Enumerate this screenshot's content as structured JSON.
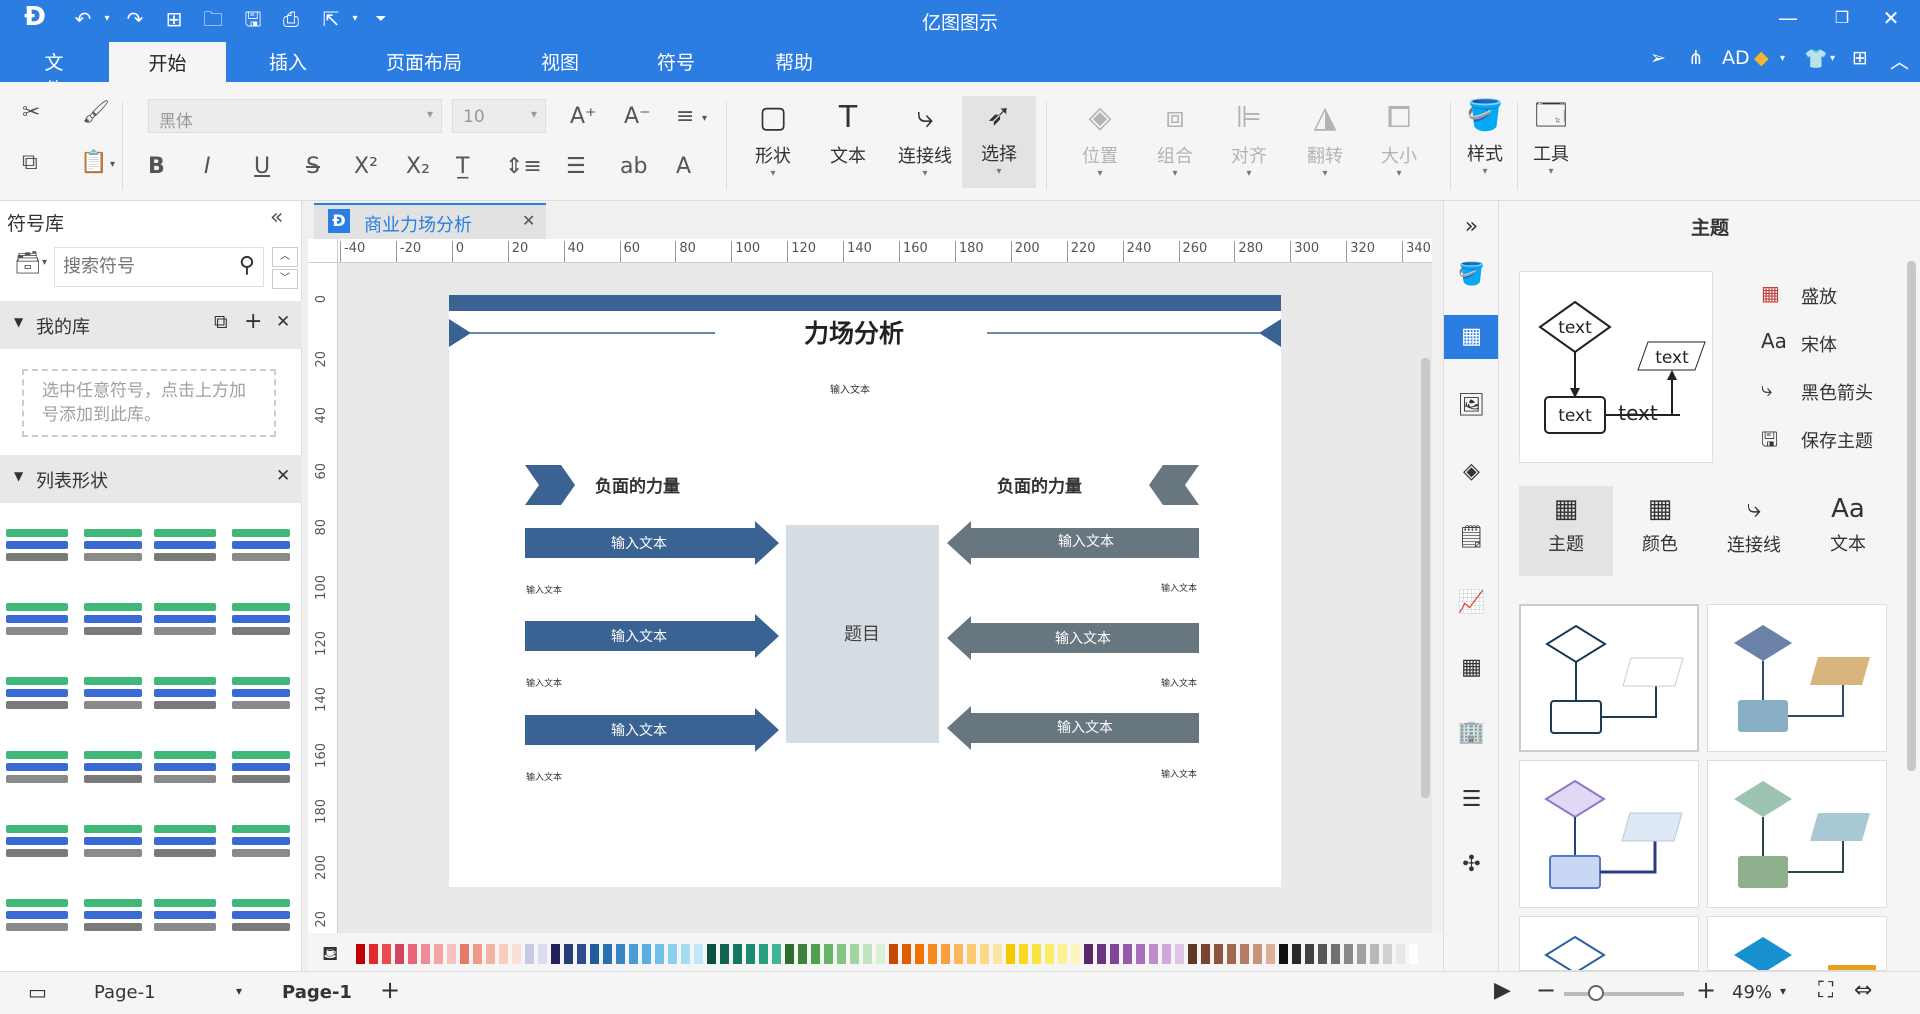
{
  "app": {
    "title": "亿图图示"
  },
  "menu": {
    "file": "文件",
    "start": "开始",
    "insert": "插入",
    "layout": "页面布局",
    "view": "视图",
    "symbol": "符号",
    "help": "帮助",
    "user": "AD"
  },
  "ribbon": {
    "font_name": "黑体",
    "font_size": "10",
    "shape": "形状",
    "text": "文本",
    "connector": "连接线",
    "select": "选择",
    "position": "位置",
    "group": "组合",
    "align": "对齐",
    "flip": "翻转",
    "size": "大小",
    "style": "样式",
    "tools": "工具"
  },
  "left_panel": {
    "title": "符号库",
    "search_placeholder": "搜索符号",
    "my_library": "我的库",
    "my_library_hint": "选中任意符号，点击上方加号添加到此库。",
    "list_shapes": "列表形状"
  },
  "document": {
    "tab_title": "商业力场分析",
    "h_ruler": [
      "-40",
      "-20",
      "0",
      "20",
      "40",
      "60",
      "80",
      "100",
      "120",
      "140",
      "160",
      "180",
      "200",
      "220",
      "240",
      "260",
      "280",
      "300",
      "320",
      "340"
    ],
    "v_ruler": [
      "0",
      "20",
      "40",
      "60",
      "80",
      "100",
      "120",
      "140",
      "160",
      "180",
      "200",
      "20"
    ]
  },
  "diagram": {
    "title": "力场分析",
    "subtitle": "输入文本",
    "left_header": "负面的力量",
    "right_header": "负面的力量",
    "center": "题目",
    "left_items": [
      {
        "label": "输入文本",
        "note": "输入文本"
      },
      {
        "label": "输入文本",
        "note": "输入文本"
      },
      {
        "label": "输入文本",
        "note": "输入文本"
      }
    ],
    "right_items": [
      {
        "label": "输入文本",
        "note": "输入文本"
      },
      {
        "label": "输入文本",
        "note": "输入文本"
      },
      {
        "label": "输入文本",
        "note": "输入文本"
      }
    ],
    "colors": {
      "blue": "#3a6394",
      "gray": "#687680",
      "center": "#d6dde3"
    }
  },
  "right_panel": {
    "title": "主题",
    "options": {
      "bloom": "盛放",
      "font": "宋体",
      "arrow": "黑色箭头",
      "save": "保存主题"
    },
    "preview_text": "text",
    "tabs": {
      "theme": "主题",
      "color": "颜色",
      "connector": "连接线",
      "text": "文本"
    }
  },
  "status": {
    "page_selector": "Page-1",
    "current_page": "Page-1",
    "zoom": "49%"
  },
  "palette": [
    "#c00000",
    "#e02a2a",
    "#e84c4c",
    "#d2445f",
    "#e8667a",
    "#f08a9a",
    "#f4a3a3",
    "#f8c0c0",
    "#e87a6a",
    "#f09a88",
    "#f4b4a4",
    "#f8cdc0",
    "#fbe0d8",
    "#c8c8e8",
    "#dcdcf0",
    "#20205c",
    "#283c78",
    "#2c4c8c",
    "#1e5c9c",
    "#2a70b0",
    "#3a86c4",
    "#4a9ad4",
    "#5aaee0",
    "#72c0e8",
    "#8ad0f0",
    "#a4dcf4",
    "#c0e8f8",
    "#0a5040",
    "#0e6450",
    "#127860",
    "#1a8a70",
    "#28a080",
    "#40b494",
    "#2c6c2c",
    "#3c843c",
    "#50a050",
    "#68b468",
    "#84c484",
    "#a0d4a0",
    "#c0e4c0",
    "#d8f0d8",
    "#c84800",
    "#e05c00",
    "#f07000",
    "#f48a20",
    "#f8a040",
    "#fcb858",
    "#fcc870",
    "#fcd888",
    "#fce4a4",
    "#f8c800",
    "#fcd820",
    "#fce440",
    "#fcec68",
    "#fcf290",
    "#fcf6b8",
    "#5a2868",
    "#6c3480",
    "#804498",
    "#9458ac",
    "#a870bc",
    "#bc8ccc",
    "#d0a8dc",
    "#e0c4e8",
    "#603828",
    "#784430",
    "#8c5440",
    "#a06850",
    "#b47c64",
    "#c8947c",
    "#dcb098",
    "#101010",
    "#282828",
    "#404040",
    "#585858",
    "#707070",
    "#888888",
    "#a0a0a0",
    "#b8b8b8",
    "#d0d0d0",
    "#e8e8e8",
    "#ffffff"
  ]
}
